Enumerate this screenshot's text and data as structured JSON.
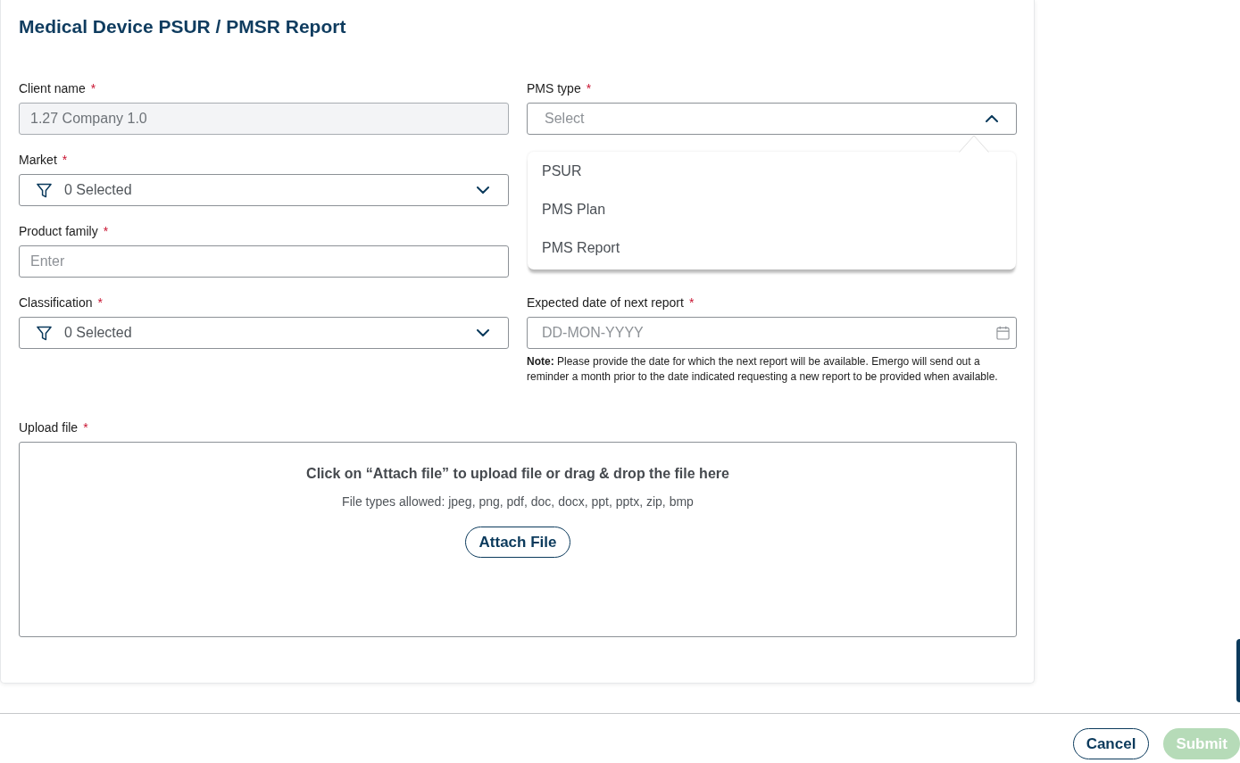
{
  "form": {
    "title": "Medical Device PSUR / PMSR Report",
    "columns": [
      {
        "fields": [
          {
            "kind": "text",
            "label": "Client name",
            "required_mark": "*",
            "value": "1.27 Company 1.0",
            "disabled": true
          },
          {
            "kind": "multiselect",
            "label": "Market",
            "required_mark": "*",
            "value": "0 Selected",
            "expanded": false
          },
          {
            "kind": "text",
            "label": "Product family",
            "required_mark": "*",
            "placeholder": "Enter",
            "disabled": false
          },
          {
            "kind": "multiselect",
            "label": "Classification",
            "required_mark": "*",
            "value": "0 Selected",
            "expanded": false
          }
        ]
      },
      {
        "fields": [
          {
            "kind": "select",
            "label": "PMS type",
            "required_mark": "*",
            "placeholder": "Select",
            "expanded": true,
            "options": [
              {
                "label": "PSUR",
                "selected": false
              },
              {
                "label": "PMS Plan",
                "selected": false
              },
              {
                "label": "PMS Report",
                "selected": false
              }
            ]
          },
          {
            "kind": "date",
            "label": "Expected date of next report",
            "required_mark": "*",
            "placeholder": "DD-MON-YYYY",
            "note": "**Note:** Please provide the date for which the next report will be available. Emergo will send out a reminder a month prior to the date indicated requesting a new report to be provided when available."
          }
        ]
      }
    ],
    "upload": {
      "label": "Upload file",
      "required_mark": "*",
      "instruction": "Click on “Attach file” to upload file or drag & drop the file here",
      "allowed_types": "File types allowed: jpeg, png, pdf, doc, docx, ppt, pptx, zip, bmp",
      "button": "Attach File"
    }
  },
  "footer": {
    "buttons": [
      {
        "kind": "secondary",
        "label": "Cancel",
        "disabled": false
      },
      {
        "kind": "primary",
        "label": "Submit",
        "disabled": true
      }
    ]
  }
}
